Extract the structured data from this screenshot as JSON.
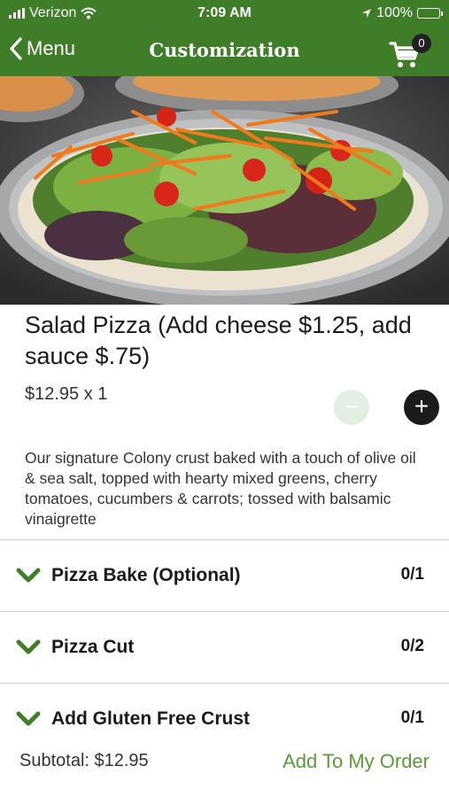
{
  "status_bar": {
    "carrier": "Verizon",
    "time": "7:09 AM",
    "battery": "100%"
  },
  "nav": {
    "back_label": "Menu",
    "title": "Customization",
    "cart_count": "0"
  },
  "item": {
    "title": "Salad Pizza (Add cheese $1.25, add sauce $.75)",
    "price_line": "$12.95 x 1",
    "description": "Our signature Colony crust baked with a touch of olive oil & sea salt, topped with hearty mixed greens, cherry tomatoes, cucumbers & carrots; tossed with balsamic vinaigrette"
  },
  "options": [
    {
      "label": "Pizza Bake (Optional)",
      "count": "0/1"
    },
    {
      "label": "Pizza Cut",
      "count": "0/2"
    },
    {
      "label": "Add Gluten Free Crust",
      "count": "0/1"
    }
  ],
  "footer": {
    "subtotal": "Subtotal: $12.95",
    "add_label": "Add To My Order"
  },
  "colors": {
    "brand_green": "#3f7d28",
    "accent_green": "#5a9a3a"
  },
  "icons": {
    "back": "chevron-left-icon",
    "cart": "cart-icon",
    "option_toggle": "chevron-down-icon",
    "minus": "minus-icon",
    "plus": "plus-icon"
  }
}
